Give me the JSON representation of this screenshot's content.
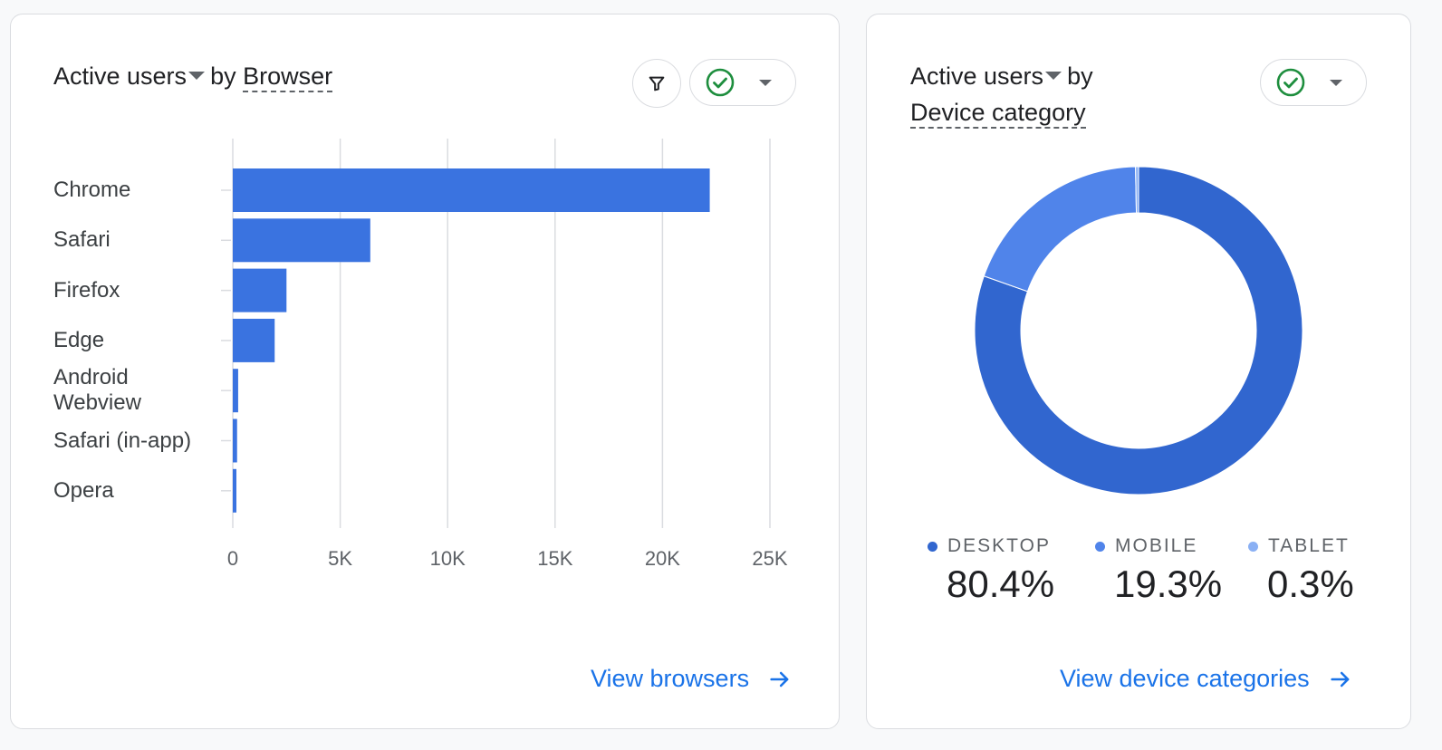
{
  "browser_card": {
    "metric": "Active users",
    "by": "by",
    "dimension": "Browser",
    "filter_icon": "filter-icon",
    "status_icon": "check-circle-icon",
    "link": "View browsers",
    "link_icon": "arrow-right-icon"
  },
  "device_card": {
    "metric": "Active users",
    "by": "by",
    "dimension": "Device category",
    "status_icon": "check-circle-icon",
    "link": "View device categories",
    "link_icon": "arrow-right-icon"
  },
  "colors": {
    "bar": "#3a73e0",
    "desktop": "#3166cf",
    "mobile": "#5084ea",
    "tablet": "#8ab0f4",
    "link": "#1a73e8",
    "check": "#1e8e3e"
  },
  "chart_data": [
    {
      "type": "bar",
      "orientation": "horizontal",
      "categories": [
        "Chrome",
        "Safari",
        "Firefox",
        "Edge",
        "Android\nWebview",
        "Safari (in-app)",
        "Opera"
      ],
      "values": [
        22200,
        6400,
        2500,
        1950,
        250,
        200,
        120
      ],
      "xticks": [
        "0",
        "5K",
        "10K",
        "15K",
        "20K",
        "25K"
      ],
      "xlim": [
        0,
        25000
      ],
      "grid": true
    },
    {
      "type": "pie",
      "donut": true,
      "slices": [
        {
          "name": "DESKTOP",
          "value": 80.4,
          "label": "80.4%"
        },
        {
          "name": "MOBILE",
          "value": 19.3,
          "label": "19.3%"
        },
        {
          "name": "TABLET",
          "value": 0.3,
          "label": "0.3%"
        }
      ],
      "legend_position": "bottom"
    }
  ]
}
